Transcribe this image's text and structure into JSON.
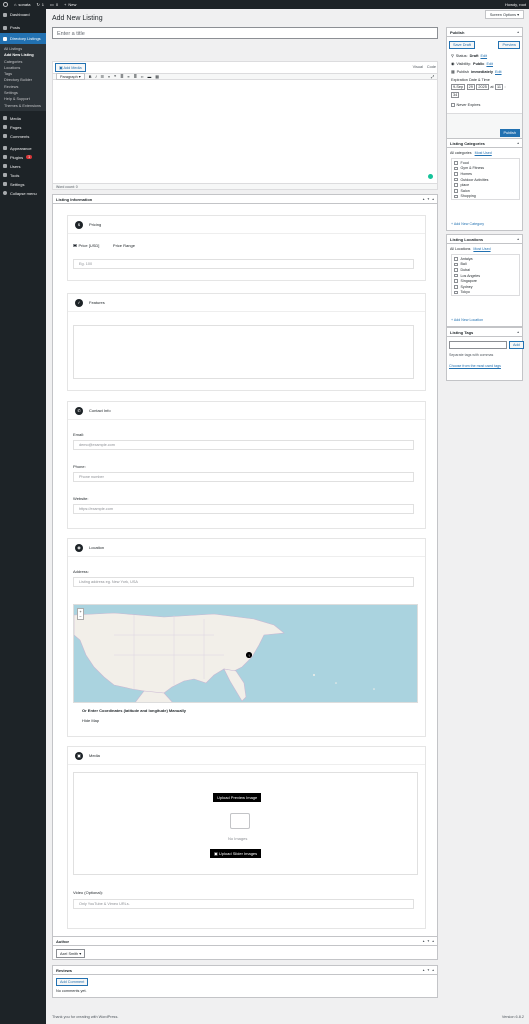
{
  "adminbar": {
    "site_name": "sonata",
    "updates": "1",
    "comments": "0",
    "new_label": "New",
    "howdy": "Howdy, root"
  },
  "sidebar": {
    "items": [
      {
        "label": "Dashboard"
      },
      {
        "label": "Posts"
      },
      {
        "label": "Directory Listings"
      },
      {
        "label": "Media"
      },
      {
        "label": "Pages"
      },
      {
        "label": "Comments"
      },
      {
        "label": "Appearance"
      },
      {
        "label": "Plugins",
        "badge": "1"
      },
      {
        "label": "Users"
      },
      {
        "label": "Tools"
      },
      {
        "label": "Settings"
      },
      {
        "label": "Collapse menu"
      }
    ],
    "submenu": [
      "All Listings",
      "Add New Listing",
      "Categories",
      "Locations",
      "Tags",
      "Directory Builder",
      "Reviews",
      "Settings",
      "Help & Support",
      "Themes & Extensions"
    ]
  },
  "screen_options": "Screen Options",
  "page_title": "Add New Listing",
  "title_placeholder": "Enter a title",
  "editor": {
    "add_media": "Add Media",
    "tab_visual": "Visual",
    "tab_code": "Code",
    "format": "Paragraph",
    "word_count": "Word count: 0"
  },
  "listing_info": {
    "title": "Listing Information",
    "pricing": {
      "title": "Pricing",
      "price_option": "Price [USD]",
      "range_option": "Price Range",
      "placeholder": "Eg. 100"
    },
    "features": {
      "title": "Features"
    },
    "contact": {
      "title": "Contact Info",
      "email_label": "Email:",
      "email_placeholder": "demo@example.com",
      "phone_label": "Phone:",
      "phone_placeholder": "Phone number",
      "website_label": "Website:",
      "website_placeholder": "https://example.com"
    },
    "location": {
      "title": "Location",
      "address_label": "Address:",
      "address_placeholder": "Listing address eg. New York, USA",
      "coords_label": "Or Enter Coordinates (latitude and longitude) Manually",
      "hide_map_label": "Hide Map",
      "zoom_in": "+",
      "zoom_out": "−"
    },
    "media": {
      "title": "Media",
      "upload_preview": "Upload Preview Image",
      "no_images": "No Images",
      "upload_slider": "Upload Slider Images",
      "video_label": "Video (Optional):",
      "video_placeholder": "Only YouTube & Vimeo URLs."
    }
  },
  "author": {
    "title": "Author",
    "value": "Axel Smith"
  },
  "reviews": {
    "title": "Reviews",
    "add_button": "Add Comment",
    "empty": "No comments yet."
  },
  "publish": {
    "title": "Publish",
    "save_draft": "Save Draft",
    "preview": "Preview",
    "status_label": "Status:",
    "status_value": "Draft",
    "visibility_label": "Visibility:",
    "visibility_value": "Public",
    "publish_label": "Publish",
    "publish_value": "immediately",
    "edit": "Edit",
    "expiration_label": "Expiration Date & Time",
    "exp_month": "9-Sep",
    "exp_day": "29",
    "exp_year": "2025",
    "exp_at": "at",
    "exp_hour": "11",
    "exp_colon": ":",
    "exp_min": "34",
    "never_expires": "Never Expires",
    "publish_button": "Publish"
  },
  "categories": {
    "title": "Listing Categories",
    "tab_all": "All categories",
    "tab_used": "Most Used",
    "items": [
      "Food",
      "Gym & Fitness",
      "Homes",
      "Outdoor Activities",
      "place",
      "Salon",
      "Shopping"
    ],
    "add_new": "+ Add New Category"
  },
  "locations": {
    "title": "Listing Locations",
    "tab_all": "All Locations",
    "tab_used": "Most Used",
    "items": [
      "Antalya",
      "Bali",
      "Dubai",
      "Los Angeles",
      "Singapore",
      "Sydney",
      "Tokyo"
    ],
    "add_new": "+ Add New Location"
  },
  "tags": {
    "title": "Listing Tags",
    "add_button": "Add",
    "hint": "Separate tags with commas",
    "choose": "Choose from the most used tags"
  },
  "footer": {
    "thanks": "Thank you for creating with WordPress.",
    "version": "Version 6.8.2"
  }
}
